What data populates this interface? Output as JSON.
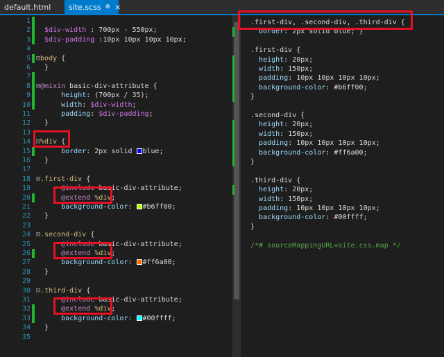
{
  "tabs": [
    {
      "label": "default.html",
      "active": false
    },
    {
      "label": "site.scss",
      "active": true,
      "pin": "⊕",
      "close": "×"
    }
  ],
  "left_lines": [
    {
      "n": "1",
      "mark": "green",
      "fold": "",
      "parts": []
    },
    {
      "n": "2",
      "mark": "green",
      "fold": "",
      "parts": [
        [
          "var",
          "  $div-width"
        ],
        [
          "txt",
          " : 700px - 550px;"
        ]
      ]
    },
    {
      "n": "3",
      "mark": "green",
      "fold": "",
      "parts": [
        [
          "var",
          "  $div-padding"
        ],
        [
          "txt",
          " :10px 10px 10px 10px;"
        ]
      ]
    },
    {
      "n": "4",
      "mark": "",
      "fold": "",
      "parts": []
    },
    {
      "n": "5",
      "mark": "green",
      "fold": "⊟",
      "parts": [
        [
          "sel",
          "body"
        ],
        [
          "txt",
          " {"
        ]
      ]
    },
    {
      "n": "6",
      "mark": "",
      "fold": "",
      "parts": [
        [
          "txt",
          "  }"
        ]
      ]
    },
    {
      "n": "7",
      "mark": "green",
      "fold": "",
      "parts": []
    },
    {
      "n": "8",
      "mark": "green",
      "fold": "⊟",
      "parts": [
        [
          "kw",
          "@mixin"
        ],
        [
          "txt",
          " basic-div-attribute {"
        ]
      ]
    },
    {
      "n": "9",
      "mark": "green",
      "fold": "",
      "parts": [
        [
          "txt",
          "      "
        ],
        [
          "prop",
          "height"
        ],
        [
          "txt",
          ": (700px / 35);"
        ]
      ]
    },
    {
      "n": "10",
      "mark": "green",
      "fold": "",
      "parts": [
        [
          "txt",
          "      "
        ],
        [
          "prop",
          "width"
        ],
        [
          "txt",
          ": "
        ],
        [
          "var",
          "$div-width"
        ],
        [
          "txt",
          ";"
        ]
      ]
    },
    {
      "n": "11",
      "mark": "",
      "fold": "",
      "parts": [
        [
          "txt",
          "      "
        ],
        [
          "prop",
          "padding"
        ],
        [
          "txt",
          ": "
        ],
        [
          "var",
          "$div-padding"
        ],
        [
          "txt",
          ";"
        ]
      ]
    },
    {
      "n": "12",
      "mark": "",
      "fold": "",
      "parts": [
        [
          "txt",
          "  }"
        ]
      ]
    },
    {
      "n": "13",
      "mark": "",
      "fold": "",
      "parts": []
    },
    {
      "n": "14",
      "mark": "",
      "fold": "⊟",
      "parts": [
        [
          "sel",
          "%div"
        ],
        [
          "txt",
          " {"
        ]
      ]
    },
    {
      "n": "15",
      "mark": "green",
      "fold": "",
      "parts": [
        [
          "txt",
          "      "
        ],
        [
          "prop",
          "border"
        ],
        [
          "txt",
          ": 2px solid "
        ],
        [
          "swatch",
          "sw-blue"
        ],
        [
          "txt",
          "blue;"
        ]
      ]
    },
    {
      "n": "16",
      "mark": "",
      "fold": "",
      "parts": [
        [
          "txt",
          "  }"
        ]
      ]
    },
    {
      "n": "17",
      "mark": "",
      "fold": "",
      "parts": []
    },
    {
      "n": "18",
      "mark": "",
      "fold": "⊟",
      "parts": [
        [
          "sel",
          ".first-div"
        ],
        [
          "txt",
          " {"
        ]
      ]
    },
    {
      "n": "19",
      "mark": "",
      "fold": "",
      "parts": [
        [
          "txt",
          "      "
        ],
        [
          "kw",
          "@include"
        ],
        [
          "txt",
          " basic-div-attribute;"
        ]
      ]
    },
    {
      "n": "20",
      "mark": "green",
      "fold": "",
      "parts": [
        [
          "txt",
          "      "
        ],
        [
          "kw",
          "@extend"
        ],
        [
          "txt",
          " "
        ],
        [
          "sel",
          "%div"
        ],
        [
          "txt",
          ";"
        ]
      ]
    },
    {
      "n": "21",
      "mark": "",
      "fold": "",
      "parts": [
        [
          "txt",
          "      "
        ],
        [
          "prop",
          "background-color"
        ],
        [
          "txt",
          ": "
        ],
        [
          "swatch",
          "sw-lime"
        ],
        [
          "txt",
          "#b6ff00;"
        ]
      ]
    },
    {
      "n": "22",
      "mark": "",
      "fold": "",
      "parts": [
        [
          "txt",
          "  }"
        ]
      ]
    },
    {
      "n": "23",
      "mark": "",
      "fold": "",
      "parts": []
    },
    {
      "n": "24",
      "mark": "",
      "fold": "⊟",
      "parts": [
        [
          "sel",
          ".second-div"
        ],
        [
          "txt",
          " {"
        ]
      ]
    },
    {
      "n": "25",
      "mark": "",
      "fold": "",
      "parts": [
        [
          "txt",
          "      "
        ],
        [
          "kw",
          "@include"
        ],
        [
          "txt",
          " basic-div-attribute;"
        ]
      ]
    },
    {
      "n": "26",
      "mark": "green",
      "fold": "",
      "parts": [
        [
          "txt",
          "      "
        ],
        [
          "kw",
          "@extend"
        ],
        [
          "txt",
          " "
        ],
        [
          "sel",
          "%div"
        ],
        [
          "txt",
          ";"
        ]
      ]
    },
    {
      "n": "27",
      "mark": "",
      "fold": "",
      "parts": [
        [
          "txt",
          "      "
        ],
        [
          "prop",
          "background-color"
        ],
        [
          "txt",
          ": "
        ],
        [
          "swatch",
          "sw-orange"
        ],
        [
          "txt",
          "#ff6a00;"
        ]
      ]
    },
    {
      "n": "28",
      "mark": "",
      "fold": "",
      "parts": [
        [
          "txt",
          "  }"
        ]
      ]
    },
    {
      "n": "29",
      "mark": "",
      "fold": "",
      "parts": []
    },
    {
      "n": "30",
      "mark": "",
      "fold": "⊟",
      "parts": [
        [
          "sel",
          ".third-div"
        ],
        [
          "txt",
          " {"
        ]
      ]
    },
    {
      "n": "31",
      "mark": "",
      "fold": "",
      "parts": [
        [
          "txt",
          "      "
        ],
        [
          "kw",
          "@include"
        ],
        [
          "txt",
          " basic-div-attribute;"
        ]
      ]
    },
    {
      "n": "32",
      "mark": "green",
      "fold": "",
      "parts": [
        [
          "txt",
          "      "
        ],
        [
          "kw",
          "@extend"
        ],
        [
          "txt",
          " "
        ],
        [
          "sel",
          "%div"
        ],
        [
          "txt",
          ";"
        ]
      ]
    },
    {
      "n": "33",
      "mark": "green",
      "fold": "",
      "parts": [
        [
          "txt",
          "      "
        ],
        [
          "prop",
          "background-color"
        ],
        [
          "txt",
          ": "
        ],
        [
          "swatch",
          "sw-cyan"
        ],
        [
          "txt",
          "#00ffff;"
        ]
      ]
    },
    {
      "n": "34",
      "mark": "",
      "fold": "",
      "parts": [
        [
          "txt",
          "  }"
        ]
      ]
    },
    {
      "n": "35",
      "mark": "",
      "fold": "",
      "parts": []
    }
  ],
  "right_lines": [
    {
      "row": 0,
      "parts": [
        [
          "txt",
          ".first-div, .second-div, .third-div {"
        ]
      ]
    },
    {
      "row": 1,
      "parts": [
        [
          "txt",
          "  "
        ],
        [
          "prop",
          "border"
        ],
        [
          "txt",
          ": 2px solid blue; }"
        ]
      ]
    },
    {
      "row": 3,
      "parts": [
        [
          "txt",
          ".first-div {"
        ]
      ]
    },
    {
      "row": 4,
      "parts": [
        [
          "txt",
          "  "
        ],
        [
          "prop",
          "height"
        ],
        [
          "txt",
          ": 20px;"
        ]
      ]
    },
    {
      "row": 5,
      "parts": [
        [
          "txt",
          "  "
        ],
        [
          "prop",
          "width"
        ],
        [
          "txt",
          ": 150px;"
        ]
      ]
    },
    {
      "row": 6,
      "parts": [
        [
          "txt",
          "  "
        ],
        [
          "prop",
          "padding"
        ],
        [
          "txt",
          ": 10px 10px 10px 10px;"
        ]
      ]
    },
    {
      "row": 7,
      "parts": [
        [
          "txt",
          "  "
        ],
        [
          "prop",
          "background-color"
        ],
        [
          "txt",
          ": #b6ff00;"
        ]
      ]
    },
    {
      "row": 8,
      "parts": [
        [
          "txt",
          "}"
        ]
      ]
    },
    {
      "row": 10,
      "parts": [
        [
          "txt",
          ".second-div {"
        ]
      ]
    },
    {
      "row": 11,
      "parts": [
        [
          "txt",
          "  "
        ],
        [
          "prop",
          "height"
        ],
        [
          "txt",
          ": 20px;"
        ]
      ]
    },
    {
      "row": 12,
      "parts": [
        [
          "txt",
          "  "
        ],
        [
          "prop",
          "width"
        ],
        [
          "txt",
          ": 150px;"
        ]
      ]
    },
    {
      "row": 13,
      "parts": [
        [
          "txt",
          "  "
        ],
        [
          "prop",
          "padding"
        ],
        [
          "txt",
          ": 10px 10px 10px 10px;"
        ]
      ]
    },
    {
      "row": 14,
      "parts": [
        [
          "txt",
          "  "
        ],
        [
          "prop",
          "background-color"
        ],
        [
          "txt",
          ": #ff6a00;"
        ]
      ]
    },
    {
      "row": 15,
      "parts": [
        [
          "txt",
          "}"
        ]
      ]
    },
    {
      "row": 17,
      "parts": [
        [
          "txt",
          ".third-div {"
        ]
      ]
    },
    {
      "row": 18,
      "parts": [
        [
          "txt",
          "  "
        ],
        [
          "prop",
          "height"
        ],
        [
          "txt",
          ": 20px;"
        ]
      ]
    },
    {
      "row": 19,
      "parts": [
        [
          "txt",
          "  "
        ],
        [
          "prop",
          "width"
        ],
        [
          "txt",
          ": 150px;"
        ]
      ]
    },
    {
      "row": 20,
      "parts": [
        [
          "txt",
          "  "
        ],
        [
          "prop",
          "padding"
        ],
        [
          "txt",
          ": 10px 10px 10px 10px;"
        ]
      ]
    },
    {
      "row": 21,
      "parts": [
        [
          "txt",
          "  "
        ],
        [
          "prop",
          "background-color"
        ],
        [
          "txt",
          ": #00ffff;"
        ]
      ]
    },
    {
      "row": 22,
      "parts": [
        [
          "txt",
          "}"
        ]
      ]
    },
    {
      "row": 24,
      "parts": [
        [
          "comment",
          "/*# sourceMappingURL=site.css.map */"
        ]
      ]
    }
  ],
  "colors": {
    "accent": "#007acc",
    "highlight_box": "#e81123",
    "change_marker": "#1fb52f"
  }
}
